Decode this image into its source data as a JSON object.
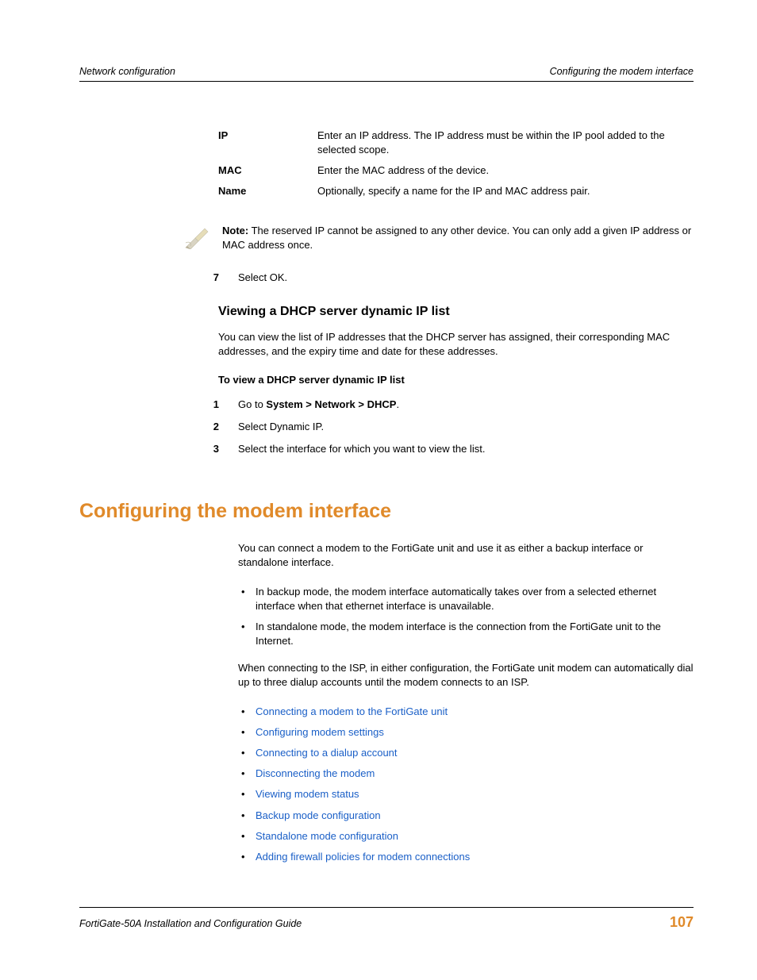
{
  "header": {
    "left": "Network configuration",
    "right": "Configuring the modem interface"
  },
  "defs": {
    "rows": [
      {
        "term": "IP",
        "desc": "Enter an IP address. The IP address must be within the IP pool added to the selected scope."
      },
      {
        "term": "MAC",
        "desc": "Enter the MAC address of the device."
      },
      {
        "term": "Name",
        "desc": "Optionally, specify a name for the IP and MAC address pair."
      }
    ]
  },
  "note": {
    "label": "Note:",
    "text": " The reserved IP cannot be assigned to any other device. You can only add a given IP address or MAC address once."
  },
  "step7": {
    "num": "7",
    "text": "Select OK."
  },
  "section_dhcp": {
    "title": "Viewing a DHCP server dynamic IP list",
    "intro": "You can view the list of IP addresses that the DHCP server has assigned, their corresponding MAC addresses, and the expiry time and date for these addresses.",
    "howto_heading": "To view a DHCP server dynamic IP list",
    "steps": [
      {
        "num": "1",
        "prefix": "Go to ",
        "bold": "System > Network > DHCP",
        "suffix": "."
      },
      {
        "num": "2",
        "prefix": "Select Dynamic IP.",
        "bold": "",
        "suffix": ""
      },
      {
        "num": "3",
        "prefix": "Select the interface for which you want to view the list.",
        "bold": "",
        "suffix": ""
      }
    ]
  },
  "section_modem": {
    "title": "Configuring the modem interface",
    "intro": "You can connect a modem to the FortiGate unit and use it as either a backup interface or standalone interface.",
    "bullets_modes": [
      "In backup mode, the modem interface automatically takes over from a selected ethernet interface when that ethernet interface is unavailable.",
      "In standalone mode, the modem interface is the connection from the FortiGate unit to the Internet."
    ],
    "para2": "When connecting to the ISP, in either configuration, the FortiGate unit modem can automatically dial up to three dialup accounts until the modem connects to an ISP.",
    "links": [
      "Connecting a modem to the FortiGate unit",
      "Configuring modem settings",
      "Connecting to a dialup account",
      "Disconnecting the modem",
      "Viewing modem status",
      "Backup mode configuration",
      "Standalone mode configuration",
      "Adding firewall policies for modem connections"
    ]
  },
  "footer": {
    "guide": "FortiGate-50A Installation and Configuration Guide",
    "page": "107"
  }
}
